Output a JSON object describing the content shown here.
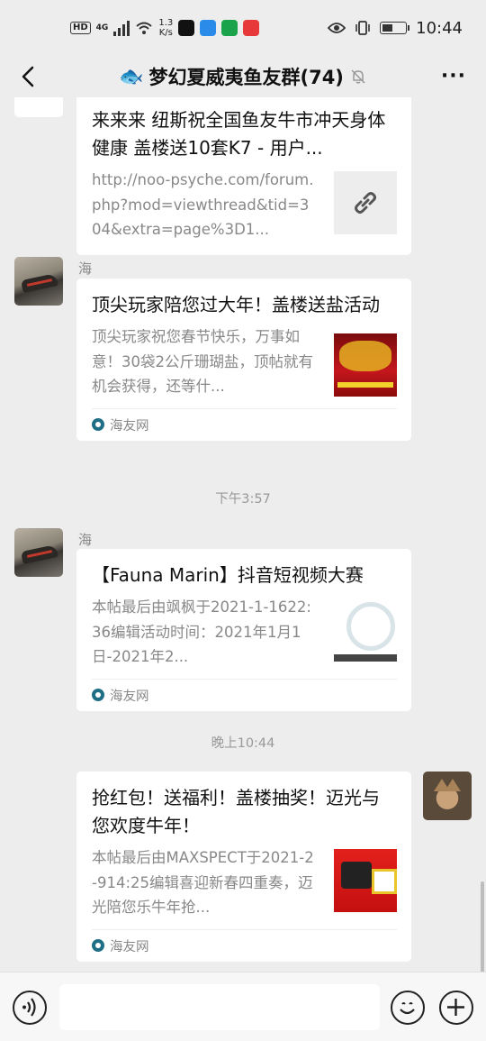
{
  "status_bar": {
    "hd": "HD",
    "network": "4G",
    "speed_value": "1.3",
    "speed_unit": "K/s",
    "time": "10:44"
  },
  "header": {
    "title": "梦幻夏威夷鱼友群(74)",
    "title_emoji": "🐟"
  },
  "messages": [
    {
      "sender": "",
      "title": "来来来 纽斯祝全国鱼友牛市冲天身体健康 盖楼送10套K7 - 用户...",
      "description": "http://noo-psyche.com/forum.php?mod=viewthread&tid=304&extra=page%3D1...",
      "source": "",
      "thumbnail": "link-icon"
    },
    {
      "sender": "海",
      "title": "顶尖玩家陪您过大年！盖楼送盐活动",
      "description": "顶尖玩家祝您春节快乐，万事如意！30袋2公斤珊瑚盐，顶帖就有机会获得，还等什...",
      "source": "海友网",
      "thumbnail": "salt-promo-image"
    },
    {
      "sender": "海",
      "title": "【Fauna Marin】抖音短视频大赛",
      "description": "本帖最后由飒枫于2021-1-1622:36编辑活动时间：2021年1月1日-2021年2...",
      "source": "海友网",
      "thumbnail": "video-contest-image"
    },
    {
      "sender": "",
      "title": "抢红包！送福利！盖楼抽奖！迈光与您欢度牛年！",
      "description": "本帖最后由MAXSPECT于2021-2-914:25编辑喜迎新春四重奏，迈光陪您乐牛年抢...",
      "source": "海友网",
      "thumbnail": "red-envelope-image"
    }
  ],
  "timestamps": [
    "下午3:57",
    "晚上10:44"
  ],
  "input": {
    "placeholder": ""
  }
}
